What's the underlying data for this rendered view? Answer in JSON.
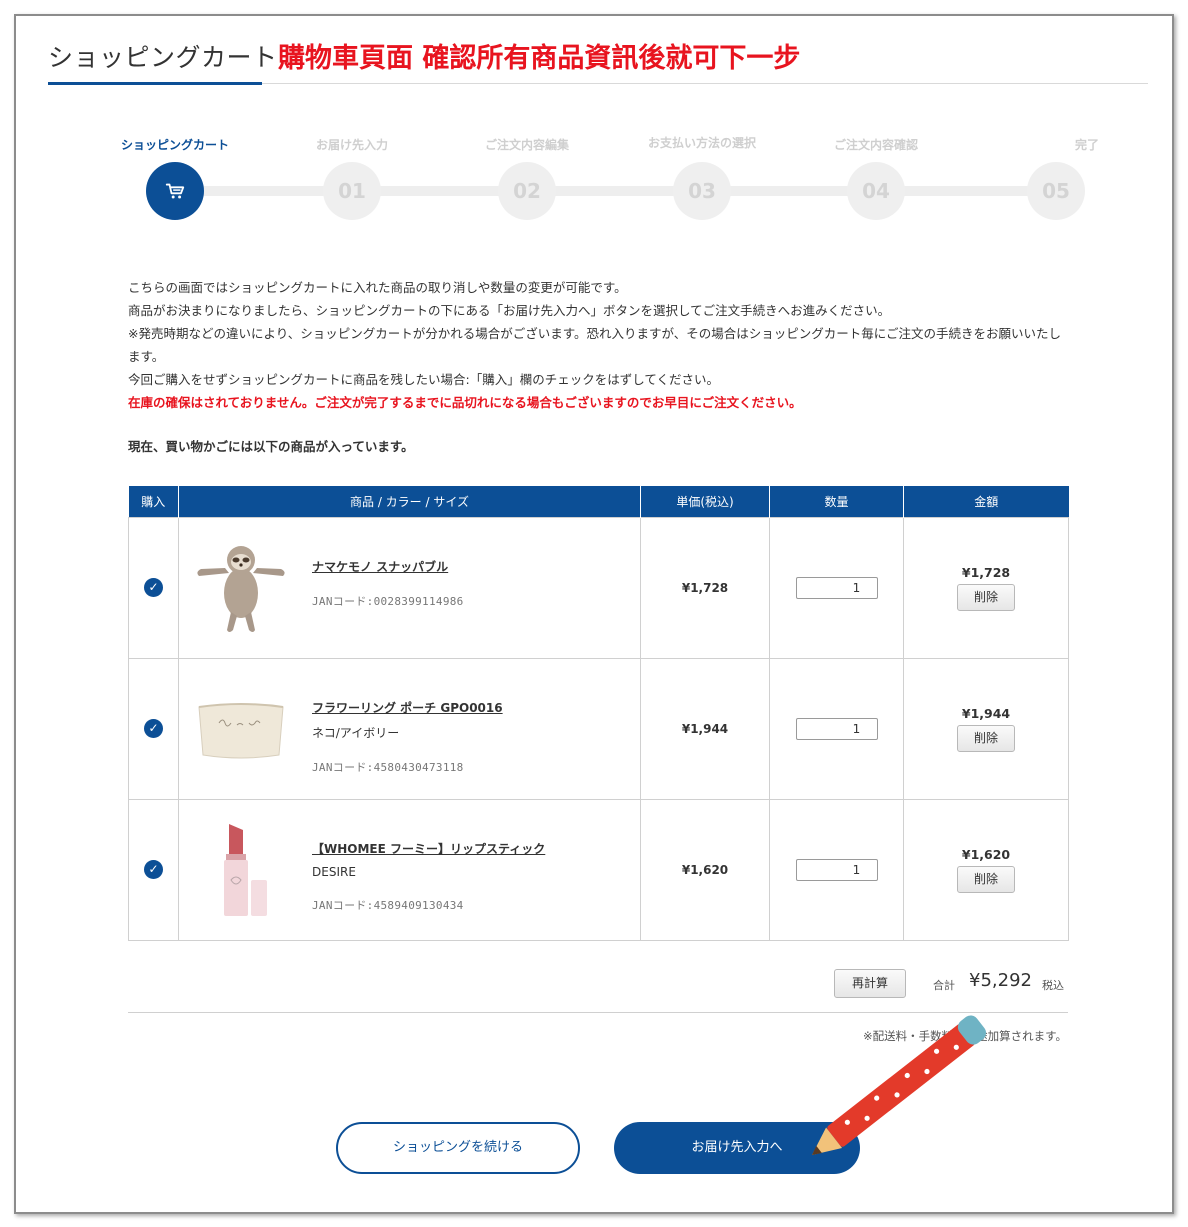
{
  "header": {
    "title": "ショッピングカート",
    "annotation": "購物車頁面 確認所有商品資訊後就可下一步"
  },
  "steps": [
    {
      "label": "ショッピングカート",
      "number": "",
      "icon": "cart-icon",
      "active": true
    },
    {
      "label": "お届け先入力",
      "number": "01",
      "active": false
    },
    {
      "label": "ご注文内容編集",
      "number": "02",
      "active": false
    },
    {
      "label": "お支払い方法の選択",
      "number": "03",
      "active": false
    },
    {
      "label": "ご注文内容確認",
      "number": "04",
      "active": false
    },
    {
      "label": "完了",
      "number": "05",
      "active": false
    }
  ],
  "intro": {
    "line1": "こちらの画面ではショッピングカートに入れた商品の取り消しや数量の変更が可能です。",
    "line2": "商品がお決まりになりましたら、ショッピングカートの下にある「お届け先入力へ」ボタンを選択してご注文手続きへお進みください。",
    "line3": "※発売時期などの違いにより、ショッピングカートが分かれる場合がございます。恐れ入りますが、その場合はショッピングカート毎にご注文の手続きをお願いいたします。",
    "line4": "今回ご購入をせずショッピングカートに商品を残したい場合:「購入」欄のチェックをはずしてください。",
    "warning": "在庫の確保はされておりません。ご注文が完了するまでに品切れになる場合もございますのでお早目にご注文ください。"
  },
  "cart_heading": "現在、買い物かごには以下の商品が入っています。",
  "table": {
    "headers": {
      "buy": "購入",
      "item": "商品 / カラー / サイズ",
      "price": "単価(税込)",
      "qty": "数量",
      "amount": "金額"
    },
    "rows": [
      {
        "name": "ナマケモノ スナッパブル",
        "variant": "",
        "jan": "JANコード:0028399114986",
        "price": "¥1,728",
        "qty": "1",
        "amount": "¥1,728",
        "delete": "削除",
        "image_icon": "sloth-plush-image"
      },
      {
        "name": "フラワーリング ポーチ GPO0016",
        "variant": "ネコ/アイボリー",
        "jan": "JANコード:4580430473118",
        "price": "¥1,944",
        "qty": "1",
        "amount": "¥1,944",
        "delete": "削除",
        "image_icon": "pouch-image"
      },
      {
        "name": "【WHOMEE フーミー】リップスティック",
        "variant": "DESIRE",
        "jan": "JANコード:4589409130434",
        "price": "¥1,620",
        "qty": "1",
        "amount": "¥1,620",
        "delete": "削除",
        "image_icon": "lipstick-image"
      }
    ]
  },
  "totals": {
    "recalc": "再計算",
    "label": "合計",
    "value": "¥5,292",
    "tax": "税込",
    "note": "※配送料・手数料は別途加算されます。"
  },
  "buttons": {
    "continue": "ショッピングを続ける",
    "next": "お届け先入力へ"
  },
  "colors": {
    "brand": "#0c4f96",
    "warning": "#e8141f"
  }
}
